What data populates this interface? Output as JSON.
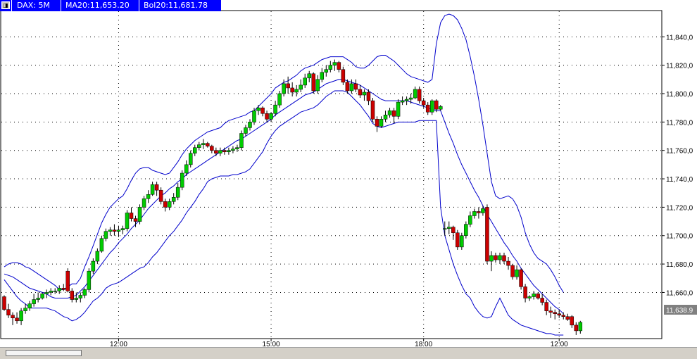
{
  "toolbar": {
    "icon": "chart-window-icon",
    "symbol": "DAX: 5M",
    "ma": "MA20:11,653.20",
    "bol": "Bol20:11,681.78"
  },
  "chart_data": {
    "type": "candlestick",
    "ylim": [
      11628,
      11858
    ],
    "yticks": [
      "11,840,0",
      "11,820,0",
      "11,800,0",
      "11,780,0",
      "11,760,0",
      "11,740,0",
      "11,720,0",
      "11,700,0",
      "11,680,0",
      "11,660,0"
    ],
    "ytick_values": [
      11840,
      11820,
      11800,
      11780,
      11760,
      11740,
      11720,
      11700,
      11680,
      11660
    ],
    "xticks": [
      {
        "label": "12:00",
        "bar": 27
      },
      {
        "label": "15:00",
        "bar": 63
      },
      {
        "label": "18:00",
        "bar": 99
      },
      {
        "label": "12:00",
        "bar": 131
      }
    ],
    "last_price": "11,638.9",
    "grid": true,
    "colors": {
      "up": "#00cc00",
      "down": "#cc0000",
      "bands": "#0000cc",
      "wick": "#000000",
      "grid": "#000000"
    },
    "candles": [
      [
        11657,
        11658,
        11647,
        11648
      ],
      [
        11648,
        11652,
        11642,
        11644
      ],
      [
        11644,
        11646,
        11637,
        11642
      ],
      [
        11642,
        11646,
        11638,
        11640
      ],
      [
        11640,
        11649,
        11637,
        11647
      ],
      [
        11647,
        11652,
        11645,
        11649
      ],
      [
        11649,
        11654,
        11647,
        11652
      ],
      [
        11652,
        11659,
        11650,
        11655
      ],
      [
        11655,
        11660,
        11653,
        11656
      ],
      [
        11656,
        11660,
        11655,
        11659
      ],
      [
        11659,
        11662,
        11656,
        11660
      ],
      [
        11660,
        11663,
        11658,
        11661
      ],
      [
        11661,
        11663,
        11659,
        11661
      ],
      [
        11661,
        11665,
        11659,
        11663
      ],
      [
        11663,
        11666,
        11661,
        11662
      ],
      [
        11675,
        11677,
        11660,
        11661
      ],
      [
        11661,
        11663,
        11653,
        11655
      ],
      [
        11655,
        11660,
        11653,
        11656
      ],
      [
        11656,
        11660,
        11653,
        11658
      ],
      [
        11658,
        11663,
        11656,
        11662
      ],
      [
        11662,
        11677,
        11660,
        11675
      ],
      [
        11675,
        11684,
        11673,
        11682
      ],
      [
        11682,
        11691,
        11680,
        11689
      ],
      [
        11689,
        11700,
        11688,
        11698
      ],
      [
        11698,
        11705,
        11696,
        11703
      ],
      [
        11703,
        11706,
        11700,
        11704
      ],
      [
        11704,
        11708,
        11700,
        11703
      ],
      [
        11703,
        11707,
        11699,
        11704
      ],
      [
        11704,
        11707,
        11701,
        11705
      ],
      [
        11705,
        11718,
        11703,
        11716
      ],
      [
        11716,
        11720,
        11710,
        11712
      ],
      [
        11712,
        11714,
        11706,
        11710
      ],
      [
        11710,
        11722,
        11708,
        11720
      ],
      [
        11720,
        11728,
        11718,
        11726
      ],
      [
        11726,
        11732,
        11723,
        11729
      ],
      [
        11729,
        11738,
        11728,
        11736
      ],
      [
        11736,
        11738,
        11728,
        11732
      ],
      [
        11732,
        11734,
        11722,
        11724
      ],
      [
        11724,
        11726,
        11717,
        11720
      ],
      [
        11720,
        11726,
        11718,
        11724
      ],
      [
        11724,
        11730,
        11722,
        11727
      ],
      [
        11727,
        11737,
        11725,
        11734
      ],
      [
        11734,
        11746,
        11732,
        11744
      ],
      [
        11744,
        11753,
        11742,
        11750
      ],
      [
        11750,
        11760,
        11748,
        11758
      ],
      [
        11758,
        11764,
        11756,
        11762
      ],
      [
        11762,
        11766,
        11760,
        11764
      ],
      [
        11764,
        11768,
        11761,
        11765
      ],
      [
        11765,
        11766,
        11762,
        11763
      ],
      [
        11763,
        11764,
        11758,
        11760
      ],
      [
        11760,
        11762,
        11756,
        11758
      ],
      [
        11758,
        11762,
        11756,
        11760
      ],
      [
        11760,
        11762,
        11757,
        11759
      ],
      [
        11759,
        11762,
        11757,
        11760
      ],
      [
        11760,
        11763,
        11758,
        11761
      ],
      [
        11761,
        11764,
        11759,
        11762
      ],
      [
        11762,
        11774,
        11760,
        11772
      ],
      [
        11772,
        11778,
        11770,
        11776
      ],
      [
        11776,
        11782,
        11774,
        11780
      ],
      [
        11780,
        11790,
        11778,
        11788
      ],
      [
        11788,
        11792,
        11785,
        11790
      ],
      [
        11790,
        11791,
        11784,
        11786
      ],
      [
        11786,
        11788,
        11780,
        11782
      ],
      [
        11782,
        11787,
        11780,
        11786
      ],
      [
        11786,
        11795,
        11784,
        11792
      ],
      [
        11792,
        11802,
        11790,
        11800
      ],
      [
        11800,
        11810,
        11798,
        11807
      ],
      [
        11807,
        11812,
        11800,
        11804
      ],
      [
        11804,
        11808,
        11798,
        11801
      ],
      [
        11801,
        11806,
        11798,
        11803
      ],
      [
        11803,
        11810,
        11801,
        11806
      ],
      [
        11806,
        11814,
        11804,
        11811
      ],
      [
        11811,
        11816,
        11808,
        11814
      ],
      [
        11814,
        11815,
        11800,
        11802
      ],
      [
        11802,
        11813,
        11800,
        11810
      ],
      [
        11810,
        11818,
        11808,
        11815
      ],
      [
        11815,
        11820,
        11812,
        11817
      ],
      [
        11817,
        11823,
        11815,
        11820
      ],
      [
        11820,
        11824,
        11816,
        11822
      ],
      [
        11822,
        11823,
        11815,
        11817
      ],
      [
        11817,
        11819,
        11806,
        11808
      ],
      [
        11808,
        11810,
        11800,
        11802
      ],
      [
        11802,
        11810,
        11800,
        11807
      ],
      [
        11807,
        11810,
        11801,
        11803
      ],
      [
        11803,
        11806,
        11797,
        11799
      ],
      [
        11799,
        11803,
        11795,
        11801
      ],
      [
        11801,
        11803,
        11792,
        11795
      ],
      [
        11795,
        11797,
        11780,
        11782
      ],
      [
        11782,
        11784,
        11773,
        11777
      ],
      [
        11777,
        11784,
        11776,
        11782
      ],
      [
        11782,
        11788,
        11780,
        11785
      ],
      [
        11785,
        11790,
        11783,
        11788
      ],
      [
        11788,
        11790,
        11779,
        11784
      ],
      [
        11784,
        11796,
        11782,
        11794
      ],
      [
        11794,
        11798,
        11792,
        11795
      ],
      [
        11795,
        11798,
        11792,
        11796
      ],
      [
        11796,
        11800,
        11793,
        11797
      ],
      [
        11797,
        11805,
        11796,
        11803
      ],
      [
        11803,
        11805,
        11793,
        11795
      ],
      [
        11795,
        11797,
        11790,
        11792
      ],
      [
        11792,
        11794,
        11785,
        11787
      ],
      [
        11787,
        11796,
        11785,
        11795
      ],
      [
        11795,
        11796,
        11787,
        11789
      ],
      [
        11789,
        11792,
        11788,
        11791
      ],
      [
        11705,
        11710,
        11700,
        11705
      ],
      [
        11705,
        11710,
        11701,
        11706
      ],
      [
        11706,
        11707,
        11697,
        11702
      ],
      [
        11702,
        11704,
        11690,
        11692
      ],
      [
        11692,
        11702,
        11690,
        11700
      ],
      [
        11700,
        11710,
        11698,
        11708
      ],
      [
        11708,
        11717,
        11706,
        11714
      ],
      [
        11714,
        11719,
        11712,
        11717
      ],
      [
        11717,
        11720,
        11712,
        11716
      ],
      [
        11716,
        11721,
        11714,
        11719
      ],
      [
        11720,
        11722,
        11680,
        11682
      ],
      [
        11682,
        11689,
        11675,
        11686
      ],
      [
        11686,
        11688,
        11681,
        11683
      ],
      [
        11683,
        11688,
        11680,
        11686
      ],
      [
        11686,
        11688,
        11680,
        11682
      ],
      [
        11682,
        11685,
        11676,
        11679
      ],
      [
        11679,
        11680,
        11669,
        11671
      ],
      [
        11671,
        11679,
        11669,
        11676
      ],
      [
        11676,
        11677,
        11662,
        11664
      ],
      [
        11664,
        11666,
        11653,
        11656
      ],
      [
        11656,
        11658,
        11654,
        11657
      ],
      [
        11657,
        11661,
        11655,
        11659
      ],
      [
        11659,
        11660,
        11655,
        11656
      ],
      [
        11656,
        11659,
        11651,
        11653
      ],
      [
        11653,
        11655,
        11644,
        11647
      ],
      [
        11647,
        11650,
        11642,
        11646
      ],
      [
        11646,
        11648,
        11641,
        11645
      ],
      [
        11645,
        11648,
        11642,
        11644
      ],
      [
        11644,
        11646,
        11641,
        11643
      ],
      [
        11643,
        11645,
        11640,
        11641
      ],
      [
        11643,
        11644,
        11635,
        11637
      ],
      [
        11637,
        11639,
        11630,
        11633
      ],
      [
        11633,
        11640,
        11631,
        11639
      ]
    ],
    "ma": [
      11673,
      11672,
      11671,
      11669,
      11667,
      11665,
      11663,
      11662,
      11661,
      11660,
      11659,
      11657,
      11656,
      11656,
      11656,
      11656,
      11657,
      11658,
      11661,
      11664,
      11668,
      11672,
      11676,
      11680,
      11684,
      11688,
      11691,
      11695,
      11698,
      11701,
      11705,
      11708,
      11711,
      11715,
      11719,
      11722,
      11725,
      11728,
      11730,
      11733,
      11735,
      11738,
      11740,
      11743,
      11745,
      11747,
      11749,
      11751,
      11753,
      11755,
      11757,
      11759,
      11761,
      11763,
      11765,
      11767,
      11768,
      11770,
      11772,
      11774,
      11776,
      11778,
      11780,
      11782,
      11785,
      11787,
      11789,
      11791,
      11793,
      11795,
      11797,
      11799,
      11800,
      11801,
      11803,
      11805,
      11807,
      11808,
      11809,
      11810,
      11810,
      11809,
      11808,
      11807,
      11806,
      11804,
      11802,
      11800,
      11798,
      11796,
      11795,
      11795,
      11795,
      11795,
      11795,
      11795,
      11794,
      11793,
      11792,
      11791,
      11790,
      11789,
      11788,
      11788,
      11780,
      11772,
      11765,
      11757,
      11750,
      11744,
      11738,
      11732,
      11727,
      11721,
      11715,
      11710,
      11705,
      11700,
      11695,
      11691,
      11686,
      11682,
      11677,
      11673,
      11669,
      11665,
      11662,
      11659,
      11656,
      11653,
      11650,
      11648,
      11645
    ],
    "upper": [
      11678,
      11680,
      11681,
      11681,
      11680,
      11678,
      11677,
      11675,
      11673,
      11671,
      11669,
      11667,
      11665,
      11662,
      11662,
      11664,
      11666,
      11666,
      11670,
      11678,
      11685,
      11693,
      11701,
      11709,
      11715,
      11720,
      11723,
      11726,
      11728,
      11733,
      11739,
      11744,
      11747,
      11748,
      11748,
      11746,
      11745,
      11744,
      11743,
      11744,
      11748,
      11752,
      11757,
      11761,
      11764,
      11767,
      11769,
      11771,
      11773,
      11774,
      11775,
      11776,
      11779,
      11781,
      11782,
      11783,
      11784,
      11785,
      11787,
      11788,
      11791,
      11794,
      11797,
      11800,
      11804,
      11806,
      11808,
      11809,
      11811,
      11813,
      11816,
      11818,
      11819,
      11820,
      11822,
      11824,
      11825,
      11826,
      11826,
      11826,
      11826,
      11824,
      11822,
      11819,
      11818,
      11818,
      11820,
      11823,
      11826,
      11827,
      11827,
      11825,
      11823,
      11820,
      11817,
      11814,
      11812,
      11811,
      11810,
      11809,
      11808,
      11810,
      11835,
      11850,
      11855,
      11856,
      11855,
      11852,
      11846,
      11838,
      11826,
      11812,
      11796,
      11778,
      11758,
      11738,
      11728,
      11726,
      11727,
      11728,
      11726,
      11721,
      11713,
      11702,
      11694,
      11688,
      11684,
      11682,
      11680,
      11676,
      11671,
      11665,
      11660
    ],
    "lower": [
      11669,
      11665,
      11661,
      11657,
      11654,
      11652,
      11649,
      11649,
      11649,
      11649,
      11649,
      11648,
      11647,
      11645,
      11643,
      11642,
      11640,
      11641,
      11643,
      11646,
      11650,
      11654,
      11656,
      11659,
      11663,
      11665,
      11666,
      11667,
      11669,
      11671,
      11673,
      11675,
      11677,
      11678,
      11681,
      11685,
      11688,
      11692,
      11696,
      11700,
      11703,
      11707,
      11711,
      11716,
      11720,
      11724,
      11729,
      11733,
      11738,
      11740,
      11741,
      11742,
      11742,
      11742,
      11743,
      11743,
      11744,
      11745,
      11747,
      11751,
      11755,
      11759,
      11765,
      11770,
      11774,
      11777,
      11779,
      11781,
      11783,
      11785,
      11787,
      11788,
      11789,
      11790,
      11792,
      11795,
      11798,
      11800,
      11802,
      11802,
      11802,
      11801,
      11798,
      11795,
      11792,
      11788,
      11784,
      11779,
      11777,
      11776,
      11777,
      11778,
      11779,
      11780,
      11780,
      11780,
      11780,
      11780,
      11781,
      11781,
      11781,
      11781,
      11781,
      11720,
      11700,
      11690,
      11680,
      11672,
      11665,
      11659,
      11656,
      11650,
      11646,
      11643,
      11642,
      11643,
      11650,
      11656,
      11650,
      11644,
      11641,
      11639,
      11637,
      11636,
      11635,
      11634,
      11633,
      11632,
      11631,
      11631,
      11630,
      11630,
      11630
    ]
  }
}
